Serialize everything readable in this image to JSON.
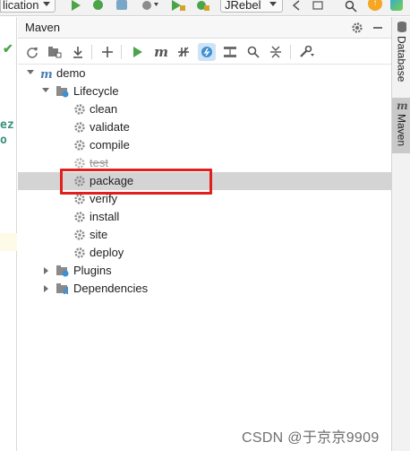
{
  "topbar": {
    "run_config_label": "lication",
    "jrebel_label": "JRebel"
  },
  "editor_fragment": {
    "code_text": "ez",
    "code_text2": "o"
  },
  "maven_panel": {
    "title": "Maven",
    "toolbar_tools": [
      "reload-icon",
      "add-project-icon",
      "download-icon",
      "plus-icon",
      "run-icon",
      "maven-goal-icon",
      "toggle-offline-icon",
      "skip-tests-icon",
      "show-dependencies-icon",
      "search-icon",
      "collapse-all-icon",
      "settings-wrench-icon"
    ],
    "tree": {
      "root": "demo",
      "lifecycle_label": "Lifecycle",
      "goals": [
        "clean",
        "validate",
        "compile",
        "test",
        "package",
        "verify",
        "install",
        "site",
        "deploy"
      ],
      "skipped_goal": "test",
      "selected_goal": "package",
      "plugins_label": "Plugins",
      "dependencies_label": "Dependencies"
    }
  },
  "right_strip": {
    "tabs": [
      {
        "label": "Database",
        "active": false
      },
      {
        "label": "Maven",
        "active": true
      }
    ]
  },
  "watermark": "CSDN @于京京9909",
  "colors": {
    "accent_green": "#4aa44a",
    "highlight_red": "#e0201c",
    "selected_row": "#d4d4d4",
    "active_tool": "#cfe3f6"
  }
}
